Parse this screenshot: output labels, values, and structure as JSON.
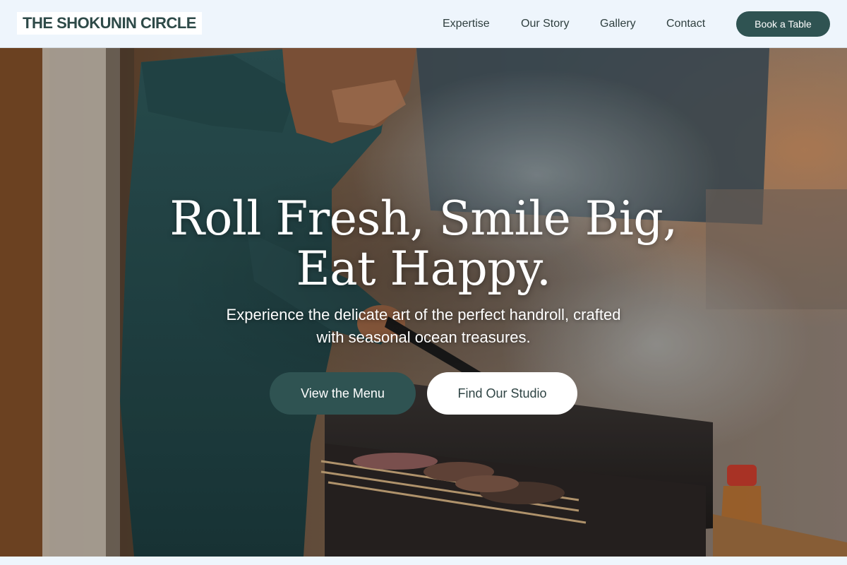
{
  "brand": {
    "name": "THE SHOKUNIN CIRCLE"
  },
  "nav": {
    "items": [
      {
        "label": "Expertise"
      },
      {
        "label": "Our Story"
      },
      {
        "label": "Gallery"
      },
      {
        "label": "Contact"
      }
    ],
    "cta_label": "Book a Table"
  },
  "hero": {
    "title_line1": "Roll Fresh, Smile Big,",
    "title_line2": "Eat Happy.",
    "subtitle_line1": "Experience the delicate art of the perfect handroll, crafted",
    "subtitle_line2": "with seasonal ocean treasures.",
    "primary_cta": "View the Menu",
    "secondary_cta": "Find Our Studio",
    "image_subject": "chef grilling yakitori skewers over charcoal"
  },
  "colors": {
    "header_bg": "#eef5fc",
    "brand_text": "#2e4a48",
    "accent": "#2f5352",
    "hero_text": "#ffffff"
  }
}
